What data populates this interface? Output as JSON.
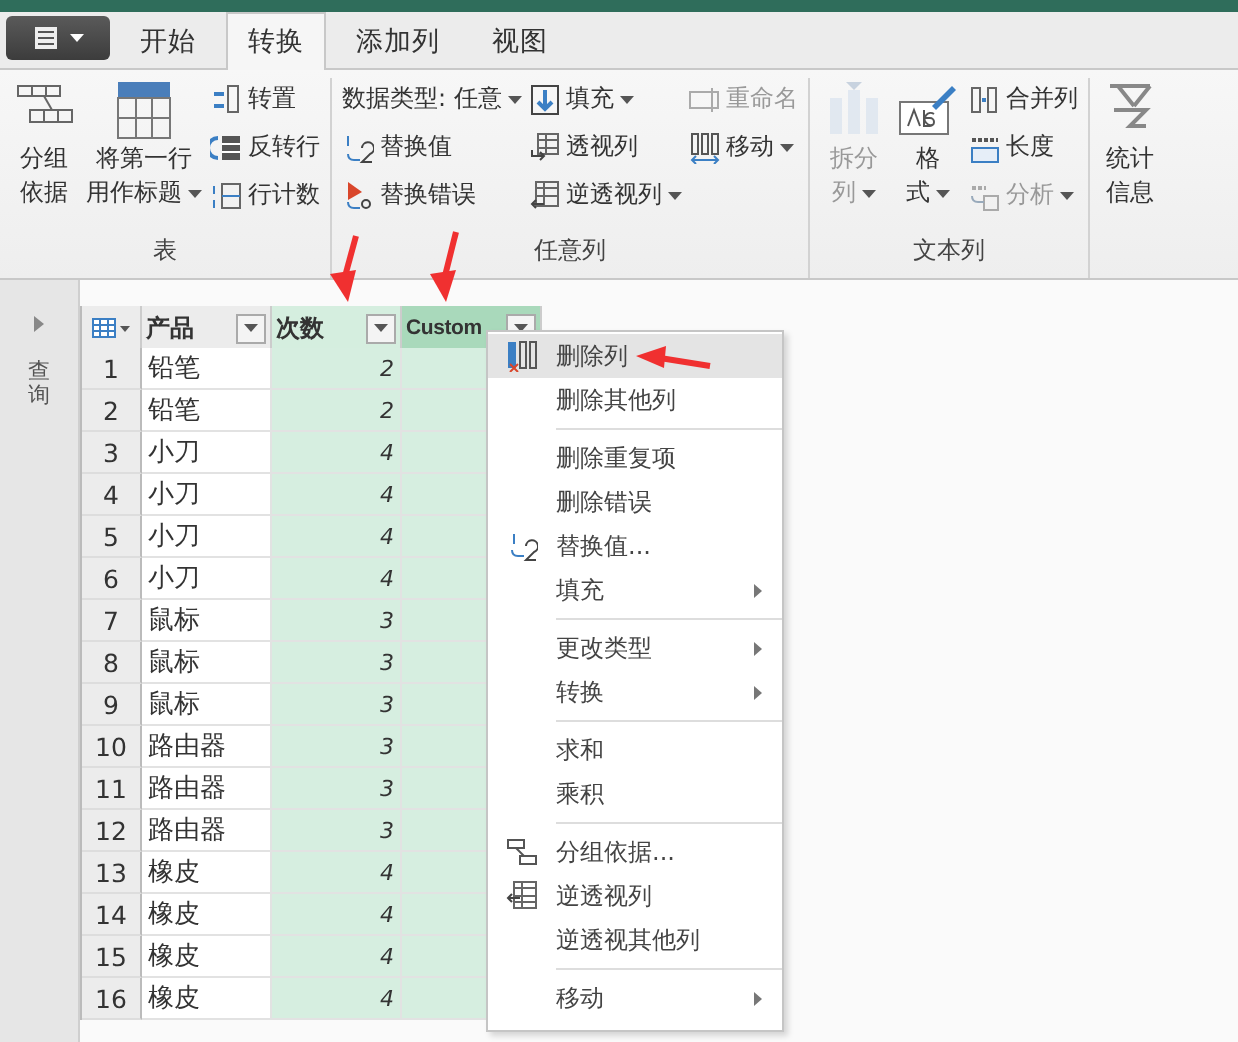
{
  "tabs": [
    {
      "label": "开始",
      "selected": false
    },
    {
      "label": "转换",
      "selected": true
    },
    {
      "label": "添加列",
      "selected": false
    },
    {
      "label": "视图",
      "selected": false
    }
  ],
  "ribbon_groups": [
    {
      "label": "表",
      "columns": [
        [
          {
            "kind": "large",
            "lines": [
              "分组",
              "依据"
            ],
            "dropdown": false,
            "disabled": false
          }
        ],
        [
          {
            "kind": "large",
            "lines": [
              "将第一行",
              "用作标题"
            ],
            "dropdown": true,
            "disabled": false
          }
        ],
        [
          {
            "kind": "small",
            "lines": [
              "转置"
            ],
            "dropdown": false,
            "disabled": false
          },
          {
            "kind": "small",
            "lines": [
              "反转行"
            ],
            "dropdown": false,
            "disabled": false
          },
          {
            "kind": "small",
            "lines": [
              "行计数"
            ],
            "dropdown": false,
            "disabled": false
          }
        ]
      ]
    },
    {
      "label": "任意列",
      "columns": [
        [
          {
            "kind": "small",
            "lines": [
              "数据类型: 任意"
            ],
            "dropdown": true,
            "disabled": false
          },
          {
            "kind": "small",
            "lines": [
              "替换值"
            ],
            "dropdown": false,
            "disabled": false
          },
          {
            "kind": "small",
            "lines": [
              "替换错误"
            ],
            "dropdown": false,
            "disabled": false
          }
        ],
        [
          {
            "kind": "small",
            "lines": [
              "填充"
            ],
            "dropdown": true,
            "disabled": false
          },
          {
            "kind": "small",
            "lines": [
              "透视列"
            ],
            "dropdown": false,
            "disabled": false
          },
          {
            "kind": "small",
            "lines": [
              "逆透视列"
            ],
            "dropdown": true,
            "disabled": false
          }
        ],
        [
          {
            "kind": "small",
            "lines": [
              "重命名"
            ],
            "dropdown": false,
            "disabled": true
          },
          {
            "kind": "small",
            "lines": [
              "移动"
            ],
            "dropdown": true,
            "disabled": false
          }
        ]
      ]
    },
    {
      "label": "文本列",
      "columns": [
        [
          {
            "kind": "large",
            "lines": [
              "拆分",
              "列"
            ],
            "dropdown": true,
            "disabled": true
          }
        ],
        [
          {
            "kind": "large",
            "lines": [
              "格",
              "式"
            ],
            "dropdown": true,
            "disabled": false
          }
        ],
        [
          {
            "kind": "small",
            "lines": [
              "合并列"
            ],
            "dropdown": false,
            "disabled": false
          },
          {
            "kind": "small",
            "lines": [
              "长度"
            ],
            "dropdown": false,
            "disabled": false
          },
          {
            "kind": "small",
            "lines": [
              "分析"
            ],
            "dropdown": true,
            "disabled": true
          }
        ]
      ]
    },
    {
      "columns": [
        [
          {
            "kind": "large",
            "lines": [
              "统计",
              "信息"
            ],
            "dropdown": false,
            "disabled": false
          }
        ]
      ]
    }
  ],
  "query_pane": {
    "title": "查询"
  },
  "table": {
    "columns": [
      {
        "label": "产品",
        "selected": false,
        "active": false
      },
      {
        "label": "次数",
        "selected": true,
        "active": false
      },
      {
        "label": "Custom",
        "selected": true,
        "active": true
      }
    ],
    "rows": [
      {
        "index": "1",
        "product": "铅笔",
        "count": "2"
      },
      {
        "index": "2",
        "product": "铅笔",
        "count": "2"
      },
      {
        "index": "3",
        "product": "小刀",
        "count": "4"
      },
      {
        "index": "4",
        "product": "小刀",
        "count": "4"
      },
      {
        "index": "5",
        "product": "小刀",
        "count": "4"
      },
      {
        "index": "6",
        "product": "小刀",
        "count": "4"
      },
      {
        "index": "7",
        "product": "鼠标",
        "count": "3"
      },
      {
        "index": "8",
        "product": "鼠标",
        "count": "3"
      },
      {
        "index": "9",
        "product": "鼠标",
        "count": "3"
      },
      {
        "index": "10",
        "product": "路由器",
        "count": "3"
      },
      {
        "index": "11",
        "product": "路由器",
        "count": "3"
      },
      {
        "index": "12",
        "product": "路由器",
        "count": "3"
      },
      {
        "index": "13",
        "product": "橡皮",
        "count": "4"
      },
      {
        "index": "14",
        "product": "橡皮",
        "count": "4"
      },
      {
        "index": "15",
        "product": "橡皮",
        "count": "4"
      },
      {
        "index": "16",
        "product": "橡皮",
        "count": "4"
      }
    ]
  },
  "context_menu": [
    {
      "kind": "item",
      "label": "删除列",
      "selected": true,
      "submenu": false
    },
    {
      "kind": "item",
      "label": "删除其他列",
      "selected": false,
      "submenu": false
    },
    {
      "kind": "separator"
    },
    {
      "kind": "item",
      "label": "删除重复项",
      "selected": false,
      "submenu": false
    },
    {
      "kind": "item",
      "label": "删除错误",
      "selected": false,
      "submenu": false
    },
    {
      "kind": "item",
      "label": "替换值...",
      "selected": false,
      "submenu": false
    },
    {
      "kind": "item",
      "label": "填充",
      "selected": false,
      "submenu": true
    },
    {
      "kind": "separator"
    },
    {
      "kind": "item",
      "label": "更改类型",
      "selected": false,
      "submenu": true
    },
    {
      "kind": "item",
      "label": "转换",
      "selected": false,
      "submenu": true
    },
    {
      "kind": "separator"
    },
    {
      "kind": "item",
      "label": "求和",
      "selected": false,
      "submenu": false
    },
    {
      "kind": "item",
      "label": "乘积",
      "selected": false,
      "submenu": false
    },
    {
      "kind": "separator"
    },
    {
      "kind": "item",
      "label": "分组依据...",
      "selected": false,
      "submenu": false
    },
    {
      "kind": "item",
      "label": "逆透视列",
      "selected": false,
      "submenu": false
    },
    {
      "kind": "item",
      "label": "逆透视其他列",
      "selected": false,
      "submenu": false
    },
    {
      "kind": "separator"
    },
    {
      "kind": "item",
      "label": "移动",
      "selected": false,
      "submenu": true
    }
  ]
}
